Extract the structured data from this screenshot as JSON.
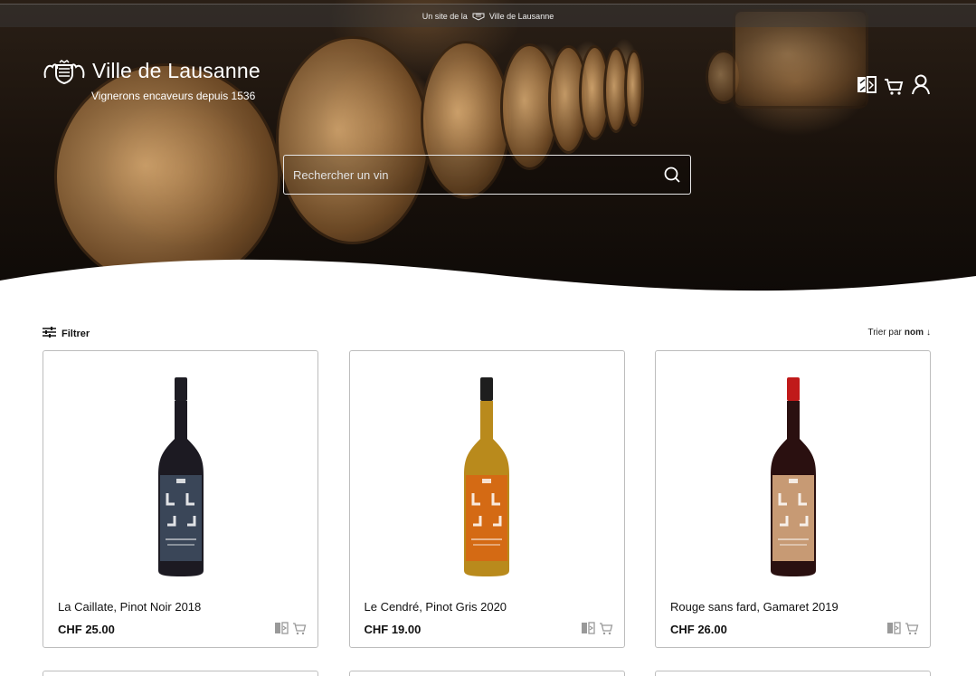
{
  "header": {
    "topbar_prefix": "Un site de la",
    "topbar_brand": "Ville de Lausanne",
    "logo_title": "Ville de Lausanne",
    "logo_subtitle": "Vignerons encaveurs depuis 1536",
    "icons": [
      "compare-icon",
      "cart-icon",
      "user-icon"
    ]
  },
  "search": {
    "placeholder": "Rechercher un vin"
  },
  "toolbar": {
    "filter_label": "Filtrer",
    "sort_prefix": "Trier par",
    "sort_value": "nom",
    "sort_arrow": "↓"
  },
  "products": [
    {
      "name": "La Caillate, Pinot Noir 2018",
      "price": "CHF 25.00",
      "bottle_color": "#1c1a22",
      "label_color": "#3a4658",
      "capsule_color": "#1e1d24"
    },
    {
      "name": "Le Cendré, Pinot Gris 2020",
      "price": "CHF 19.00",
      "bottle_color": "#b98a1c",
      "label_color": "#d46a14",
      "capsule_color": "#1e1e1e"
    },
    {
      "name": "Rouge sans fard, Gamaret 2019",
      "price": "CHF 26.00",
      "bottle_color": "#2a1010",
      "label_color": "#c79a74",
      "capsule_color": "#c01a1a"
    }
  ],
  "colors": {
    "card_border": "#bdbdbd",
    "text": "#111111"
  }
}
